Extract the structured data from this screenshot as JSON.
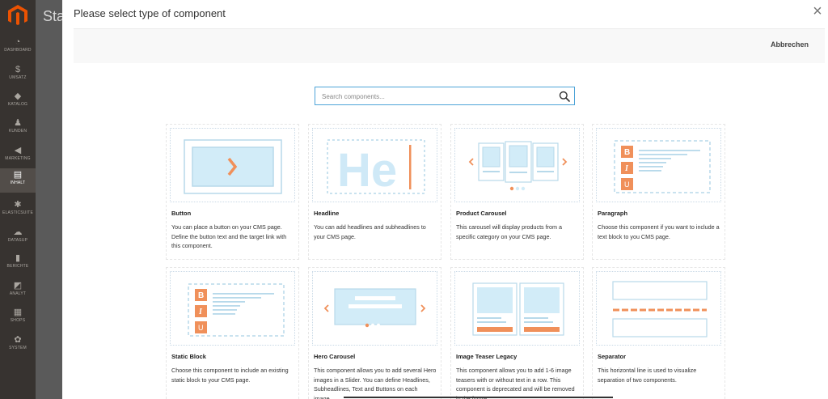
{
  "sidebar": {
    "items": [
      {
        "label": "DASHBOARD",
        "icon": "speedometer-icon"
      },
      {
        "label": "UMSATZ",
        "icon": "dollar-icon"
      },
      {
        "label": "KATALOG",
        "icon": "cube-icon"
      },
      {
        "label": "KUNDEN",
        "icon": "person-icon"
      },
      {
        "label": "MARKETING",
        "icon": "megaphone-icon"
      },
      {
        "label": "INHALT",
        "icon": "layout-icon"
      },
      {
        "label": "ELASTICSUITE",
        "icon": "gear-icon"
      },
      {
        "label": "DATASUP",
        "icon": "cloud-icon"
      },
      {
        "label": "BERICHTE",
        "icon": "bar-chart-icon"
      },
      {
        "label": "ANALYT",
        "icon": "analytics-icon"
      },
      {
        "label": "SHOPS",
        "icon": "store-icon"
      },
      {
        "label": "SYSTEM",
        "icon": "cog-icon"
      }
    ]
  },
  "page": {
    "title_fragment": "Star"
  },
  "modal": {
    "title": "Please select type of component",
    "cancel_label": "Abbrechen",
    "search_placeholder": "Search components...",
    "thumb_headline_text": "He"
  },
  "cards": [
    {
      "title": "Button",
      "desc": "You can place a button on your CMS page. Define the button text and the target link with this component."
    },
    {
      "title": "Headline",
      "desc": "You can add headlines and subheadlines to your CMS page."
    },
    {
      "title": "Product Carousel",
      "desc": "This carousel will display products from a specific category on your CMS page."
    },
    {
      "title": "Paragraph",
      "desc": "Choose this component if you want to include a text block to you CMS page."
    },
    {
      "title": "Static Block",
      "desc": "Choose this component to include an existing static block to your CMS page."
    },
    {
      "title": "Hero Carousel",
      "desc": "This component allows you to add several Hero images in a Slider. You can define Headlines, Subheadlines, Text and Buttons on each image."
    },
    {
      "title": "Image Teaser Legacy",
      "desc": "This component allows you to add 1-6 image teasers with or without text in a row. This component is deprecated and will be removed in the future."
    },
    {
      "title": "Separator",
      "desc": "This horizontal line is used to visualize separation of two components."
    }
  ],
  "colors": {
    "accent_orange": "#f0905a",
    "thumb_blue": "#c6e6f5",
    "thumb_line": "#a9cfe3",
    "sidebar_bg": "#373330",
    "logo": "#eb5202"
  }
}
